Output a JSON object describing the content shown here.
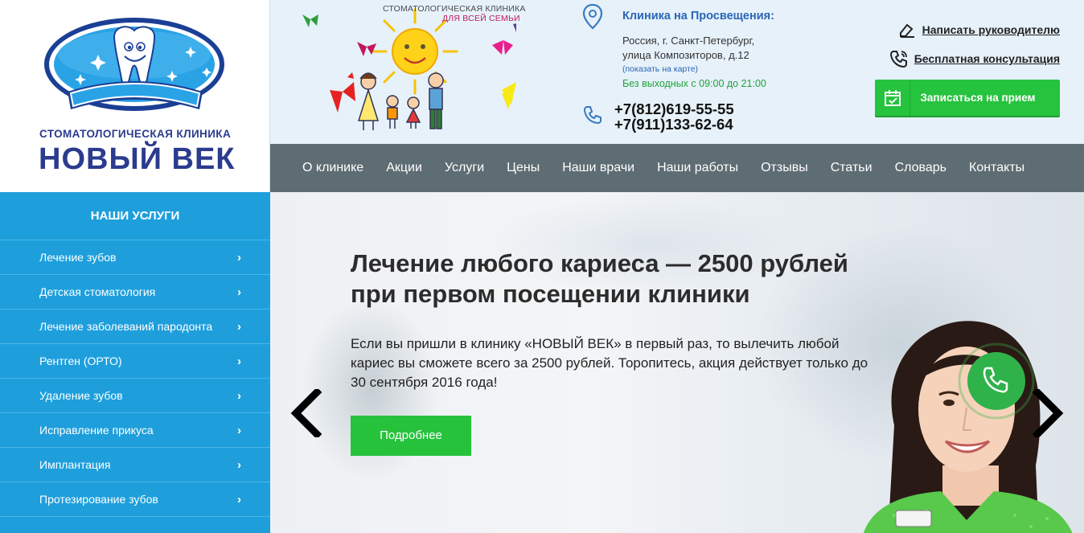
{
  "colors": {
    "brand_blue": "#2b3b8e",
    "sidebar_blue": "#1e9fdc",
    "nav_gray": "#5e6c73",
    "cta_green": "#26c33e",
    "header_bg": "#e6f1fa"
  },
  "logo": {
    "emblem_text": "НОВЫЙ ВЕК",
    "clinic_type": "СТОМАТОЛОГИЧЕСКАЯ КЛИНИКА",
    "clinic_name": "НОВЫЙ ВЕК"
  },
  "family_art": {
    "caption_1": "СТОМАТОЛОГИЧЕСКАЯ КЛИНИКА",
    "caption_2": "ДЛЯ ВСЕЙ СЕМЬИ"
  },
  "address": {
    "title": "Клиника на Просвещения:",
    "line_1": "Россия, г. Санкт-Петербург,",
    "line_2": "улица Композиторов, д.12",
    "map_link": "(показать на карте)",
    "hours": "Без выходных с 09:00 до 21:00",
    "phone_1": "+7(812)619-55-55",
    "phone_2": "+7(911)133-62-64"
  },
  "contact_links": {
    "write_manager": "Написать руководителю",
    "free_consult": "Бесплатная консультация",
    "appointment_button": "Записаться на прием"
  },
  "nav": {
    "items": [
      "О клинике",
      "Акции",
      "Услуги",
      "Цены",
      "Наши врачи",
      "Наши работы",
      "Отзывы",
      "Статьи",
      "Словарь",
      "Контакты"
    ]
  },
  "sidebar": {
    "title": "НАШИ УСЛУГИ",
    "items": [
      "Лечение зубов",
      "Детская стоматология",
      "Лечение заболеваний пародонта",
      "Рентген (ОРТО)",
      "Удаление зубов",
      "Исправление прикуса",
      "Имплантация",
      "Протезирование зубов"
    ],
    "chevron": "›"
  },
  "slide": {
    "title_line_1": "Лечение любого кариеса — 2500 рублей",
    "title_line_2": "при первом посещении клиники",
    "text": "Если вы пришли в клинику «НОВЫЙ ВЕК» в первый раз, то вылечить любой кариес вы сможете всего за 2500 рублей. Торопитесь, акция действует только до 30 сентября 2016 года!",
    "button": "Подробнее"
  }
}
